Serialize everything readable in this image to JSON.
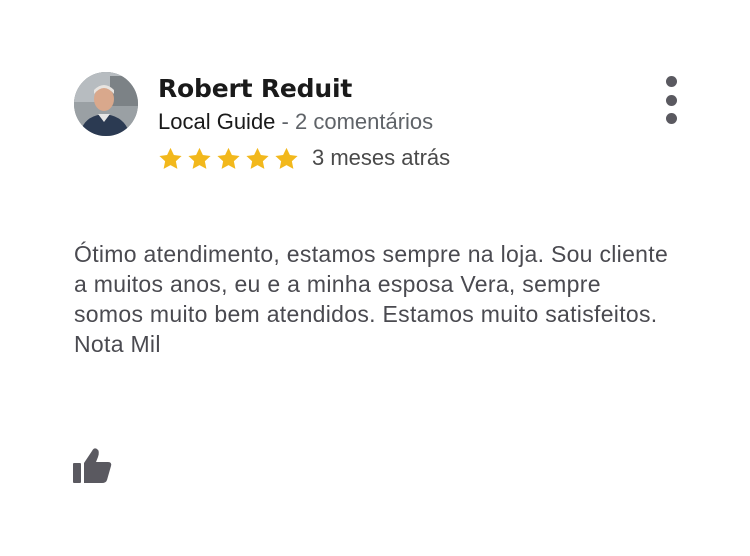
{
  "review": {
    "author": {
      "name": "Robert Reduit",
      "badge": "Local Guide",
      "separator": " - ",
      "comments": "2 comentários",
      "avatar_icon": "user-avatar"
    },
    "rating": {
      "value": 5,
      "max": 5,
      "color": "#f2b81c"
    },
    "date": "3 meses atrás",
    "text": "Ótimo atendimento, estamos sempre na loja. Sou cliente a muitos anos, eu e a minha esposa Vera, sempre somos muito bem atendidos. Estamos muito satisfeitos. Nota Mil",
    "actions": {
      "more_icon": "more-vertical-icon",
      "like_icon": "thumbs-up-icon"
    }
  },
  "colors": {
    "name": "#1a1a1a",
    "secondary": "#5f6368",
    "body": "#4a4a50",
    "icon": "#5a5960",
    "star": "#f2b81c"
  }
}
